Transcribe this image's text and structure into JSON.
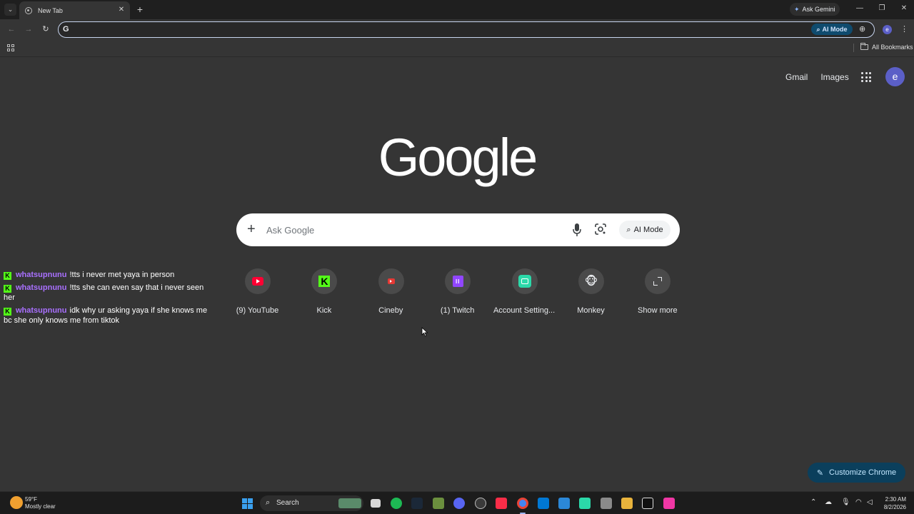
{
  "browser": {
    "tab_title": "New Tab",
    "close_glyph": "✕",
    "new_tab_glyph": "+",
    "ask_gemini_label": "Ask Gemini",
    "omnibox_value": "",
    "omnibox_ai_mode_label": "AI Mode",
    "profile_initial": "e",
    "all_bookmarks_label": "All Bookmarks"
  },
  "ntp": {
    "top_links": [
      "Gmail",
      "Images"
    ],
    "avatar_initial": "e",
    "logo_text": "Google",
    "search_placeholder": "Ask Google",
    "ai_mode_label": "AI Mode",
    "shortcuts": [
      {
        "label": "(9) YouTube",
        "icon": "youtube-icon"
      },
      {
        "label": "Kick",
        "icon": "kick-icon"
      },
      {
        "label": "Cineby",
        "icon": "cineby-icon"
      },
      {
        "label": "(1) Twitch",
        "icon": "twitch-icon"
      },
      {
        "label": "Account Setting...",
        "icon": "account-settings-icon"
      },
      {
        "label": "Monkey",
        "icon": "monkey-icon"
      },
      {
        "label": "Show more",
        "icon": "expand-icon"
      }
    ],
    "customize_label": "Customize Chrome"
  },
  "chat": {
    "badge": "K",
    "messages": [
      {
        "user": "whatsupnunu",
        "text": "!tts i never met yaya in person"
      },
      {
        "user": "whatsupnunu",
        "text": "!tts she can even say that i never seen her"
      },
      {
        "user": "whatsupnunu",
        "text": "idk why ur asking yaya if she knows me bc she only knows me from tiktok"
      }
    ]
  },
  "taskbar": {
    "weather_temp": "59°F",
    "weather_desc": "Mostly clear",
    "search_label": "Search",
    "time": "2:30 AM",
    "date": "8/2/2026"
  },
  "colors": {
    "accent": "#8ab4f8",
    "kick_green": "#53fc18",
    "chat_username": "#a970ff",
    "page_background": "#353535"
  }
}
